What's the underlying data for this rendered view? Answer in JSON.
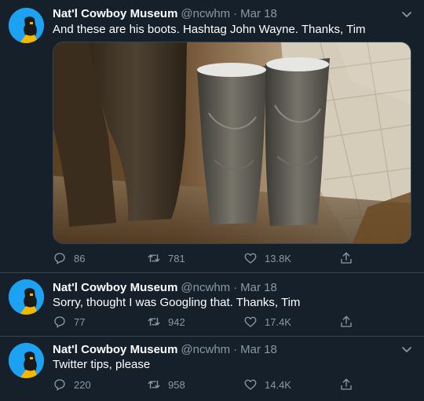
{
  "tweets": [
    {
      "name": "Nat'l Cowboy Museum",
      "handle": "@ncwhm",
      "separator": "·",
      "date": "Mar 18",
      "text": "And these are his boots. Hashtag John Wayne. Thanks, Tim",
      "has_media": true,
      "replies": "86",
      "retweets": "781",
      "likes": "13.8K"
    },
    {
      "name": "Nat'l Cowboy Museum",
      "handle": "@ncwhm",
      "separator": "·",
      "date": "Mar 18",
      "text": "Sorry, thought I was Googling that. Thanks, Tim",
      "has_media": false,
      "replies": "77",
      "retweets": "942",
      "likes": "17.4K"
    },
    {
      "name": "Nat'l Cowboy Museum",
      "handle": "@ncwhm",
      "separator": "·",
      "date": "Mar 18",
      "text": "Twitter tips, please",
      "has_media": false,
      "replies": "220",
      "retweets": "958",
      "likes": "14.4K"
    }
  ],
  "icons": {
    "reply": "reply-icon",
    "retweet": "retweet-icon",
    "like": "heart-icon",
    "share": "share-icon",
    "more": "chevron-down-icon"
  },
  "colors": {
    "background": "#15202b",
    "text": "#ffffff",
    "secondary": "#8899a6",
    "divider": "#38444d",
    "accent": "#1da1f2"
  }
}
